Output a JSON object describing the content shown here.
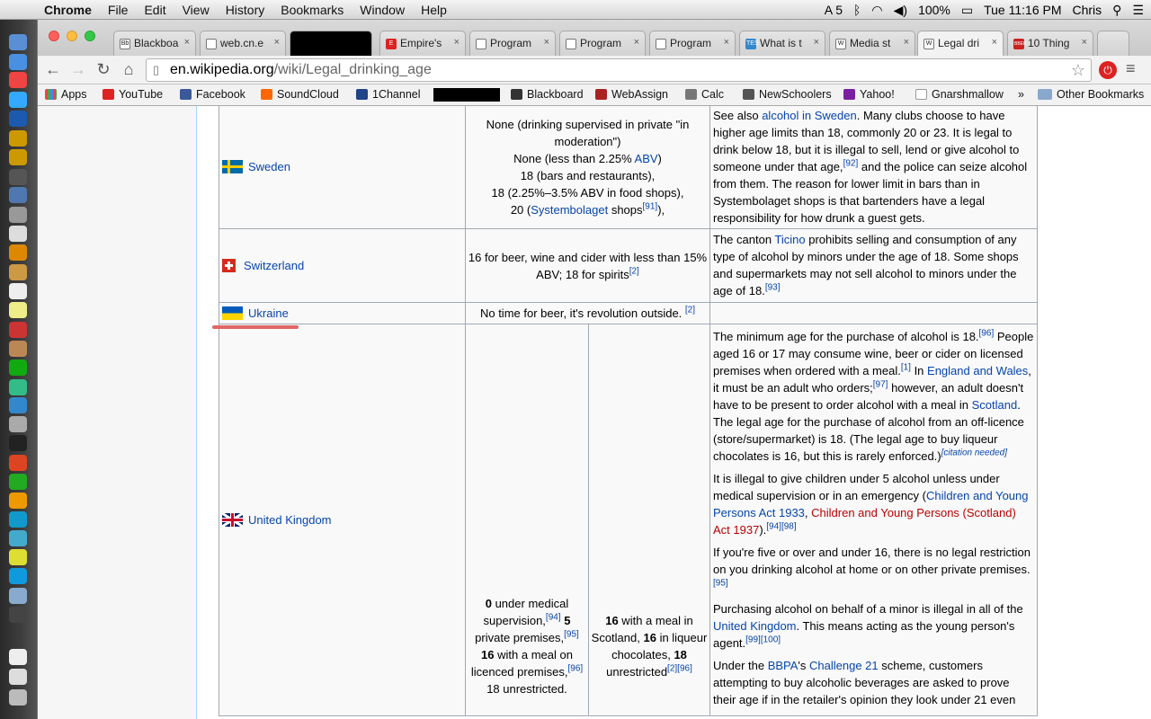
{
  "menubar": {
    "app": "Chrome",
    "items": [
      "File",
      "Edit",
      "View",
      "History",
      "Bookmarks",
      "Window",
      "Help"
    ],
    "adobe_count": "5",
    "battery": "100%",
    "clock": "Tue 11:16 PM",
    "user": "Chris"
  },
  "tabs": [
    {
      "label": "Blackboa",
      "icon": "Bb"
    },
    {
      "label": "web.cn.e",
      "icon": ""
    },
    {
      "label": "",
      "icon": ""
    },
    {
      "label": "Empire's",
      "icon": "E"
    },
    {
      "label": "Program",
      "icon": ""
    },
    {
      "label": "Program",
      "icon": ""
    },
    {
      "label": "Program",
      "icon": ""
    },
    {
      "label": "What is t",
      "icon": "TES"
    },
    {
      "label": "Media st",
      "icon": "W"
    },
    {
      "label": "Legal dri",
      "icon": "W"
    },
    {
      "label": "10 Thing",
      "icon": "BBER"
    }
  ],
  "address": {
    "host": "en.wikipedia.org",
    "path": "/wiki/Legal_drinking_age"
  },
  "bookmarks": [
    "Apps",
    "YouTube",
    "Facebook",
    "SoundCloud",
    "1Channel",
    "",
    "Blackboard",
    "WebAssign",
    "Calc",
    "NewSchoolers",
    "Yahoo!",
    "Gnarshmallow",
    "»",
    "Other Bookmarks"
  ],
  "rows": {
    "sweden": {
      "country": "Sweden",
      "age_lines": [
        "None (drinking supervised in private \"in moderation\")",
        "None (less than 2.25% ",
        "ABV",
        ")",
        "18 (bars and restaurants),",
        "18 (2.25%–3.5% ABV in food shops),",
        "20 (",
        "Systembolaget",
        " shops",
        "[91]",
        "),"
      ],
      "note_parts": [
        "See also ",
        "alcohol in Sweden",
        ". Many clubs choose to have higher age limits than 18, commonly 20 or 23. It is legal to drink below 18, but it is illegal to sell, lend or give alcohol to someone under that age,",
        "[92]",
        " and the police can seize alcohol from them. The reason for lower limit in bars than in Systembolaget shops is that bartenders have a legal responsibility for how drunk a guest gets."
      ]
    },
    "switzerland": {
      "country": "Switzerland",
      "age": "16 for beer, wine and cider with less than 15% ABV; 18 for spirits",
      "age_ref": "[2]",
      "note_parts": [
        "The canton ",
        "Ticino",
        " prohibits selling and consumption of any type of alcohol by minors under the age of 18. Some shops and supermarkets may not sell alcohol to minors under the age of 18.",
        "[93]"
      ]
    },
    "ukraine": {
      "country": "Ukraine",
      "age": "No time for beer, it's revolution outside. ",
      "age_ref": "[2]"
    },
    "uk": {
      "country": "United Kingdom",
      "col1_parts": [
        "0",
        " under medical supervision,",
        "[94]",
        " 5",
        " private premises,",
        "[95]",
        "16",
        " with a meal on licenced premises,",
        "[96]",
        " 18 unrestricted."
      ],
      "col2_parts": [
        "16",
        " with a meal in Scotland, ",
        "16",
        " in liqueur chocolates, ",
        "18",
        " unrestricted",
        "[2][96]"
      ],
      "p1": [
        "The minimum age for the purchase of alcohol is 18.",
        "[96]",
        " People aged 16 or 17 may consume wine, beer or cider on licensed premises when ordered with a meal.",
        "[1]",
        " In ",
        "England and Wales",
        ", it must be an adult who orders;",
        "[97]",
        " however, an adult doesn't have to be present to order alcohol with a meal in ",
        "Scotland",
        ". The legal age for the purchase of alcohol from an off-licence (store/supermarket) is 18. (The legal age to buy liqueur chocolates is 16, but this is rarely enforced.)",
        "[citation needed]"
      ],
      "p2": [
        "It is illegal to give children under 5 alcohol unless under medical supervision or in an emergency (",
        "Children and Young Persons Act 1933",
        ", ",
        "Children and Young Persons (Scotland) Act 1937",
        ").",
        "[94][98]"
      ],
      "p3": [
        "If you're five or over and under 16, there is no legal restriction on you drinking alcohol at home or on other private premises.",
        "[95]"
      ],
      "p4": [
        "Purchasing alcohol on behalf of a minor is illegal in all of the ",
        "United Kingdom",
        ". This means acting as the young person's agent.",
        "[99][100]"
      ],
      "p5": [
        "Under the ",
        "BBPA",
        "'s ",
        "Challenge 21",
        " scheme, customers attempting to buy alcoholic beverages are asked to prove their age if in the retailer's opinion they look under 21 even"
      ]
    }
  },
  "colors": {
    "link": "#0645ad",
    "redlink": "#ba0000",
    "border": "#a2a9b1",
    "mark": "#e06666"
  }
}
